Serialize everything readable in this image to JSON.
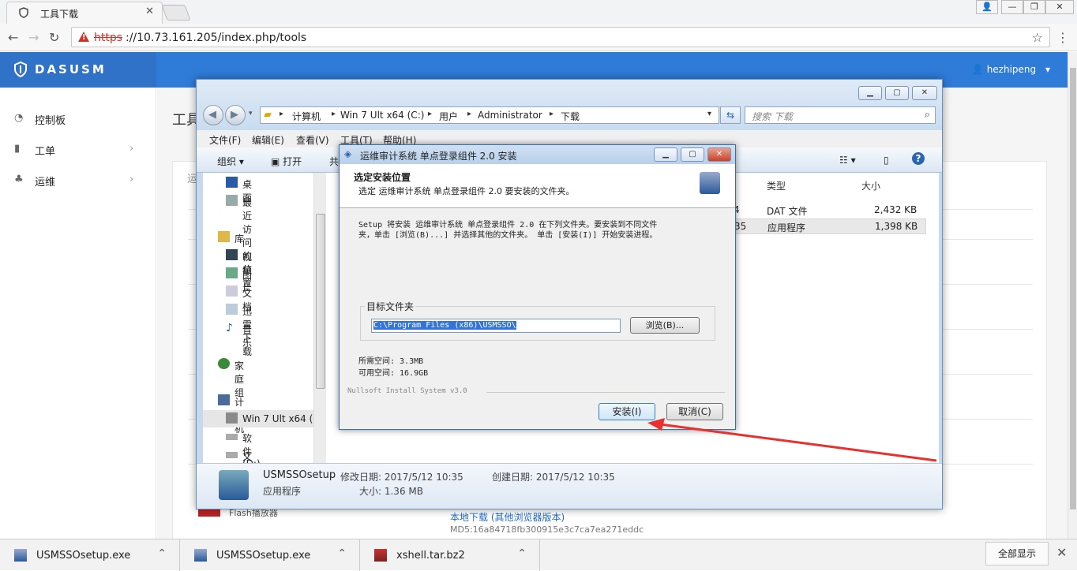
{
  "browser": {
    "tab_title": "工具下载",
    "url_scheme": "https",
    "url_rest": "://10.73.161.205/index.php/tools"
  },
  "app": {
    "brand": "DASUSM",
    "user": "hezhipeng",
    "page_title_fragment": "工具",
    "tab_fragment": "运",
    "sidebar": [
      {
        "label": "控制板",
        "icon": "dashboard-icon"
      },
      {
        "label": "工单",
        "icon": "file-icon"
      },
      {
        "label": "运维",
        "icon": "sitemap-icon"
      }
    ],
    "flash_label": "Flash播放器",
    "download_link": "本地下载 (其他浏览器版本)",
    "md5": "MD5:16a84718fb300915e3c7ca7ea271eddc"
  },
  "explorer": {
    "breadcrumb": [
      "计算机",
      "Win 7 Ult x64 (C:)",
      "用户",
      "Administrator",
      "下载"
    ],
    "search_placeholder": "搜索 下载",
    "menu": [
      "文件(F)",
      "编辑(E)",
      "查看(V)",
      "工具(T)",
      "帮助(H)"
    ],
    "commands": [
      "组织",
      "打开",
      "共"
    ],
    "nav_items": [
      "桌面",
      "最近访问的位置",
      "库",
      "视频",
      "图片",
      "文档",
      "迅雷下载",
      "音乐",
      "家庭组",
      "计算机",
      "Win 7 Ult x64 (C",
      "软件 (D:)",
      "文档 (E:)"
    ],
    "columns": {
      "type": "类型",
      "size": "大小"
    },
    "files": [
      {
        "frag": "4",
        "type": "DAT 文件",
        "size": "2,432 KB"
      },
      {
        "frag": "35",
        "type": "应用程序",
        "size": "1,398 KB"
      }
    ],
    "details": {
      "name": "USMSSOsetup",
      "modified_label": "修改日期: 2017/5/12 10:35",
      "created_label": "创建日期: 2017/5/12 10:35",
      "kind": "应用程序",
      "size_label": "大小: 1.36 MB"
    }
  },
  "installer": {
    "title": "运维审计系统 单点登录组件 2.0 安装",
    "heading": "选定安装位置",
    "subheading": "选定 运维审计系统 单点登录组件 2.0 要安装的文件夹。",
    "body_line1": "Setup 将安装 运维审计系统 单点登录组件 2.0 在下列文件夹。要安装到不同文件",
    "body_line2": "夹，单击 [浏览(B)...] 并选择其他的文件夹。 单击 [安装(I)] 开始安装进程。",
    "group_label": "目标文件夹",
    "path": "C:\\Program Files (x86)\\USMSSO\\",
    "browse": "浏览(B)...",
    "space_required": "所需空间: 3.3MB",
    "space_available": "可用空间: 16.9GB",
    "branding": "Nullsoft Install System v3.0",
    "install": "安装(I)",
    "cancel": "取消(C)"
  },
  "downloads": [
    {
      "name": "USMSSOsetup.exe"
    },
    {
      "name": "USMSSOsetup.exe"
    },
    {
      "name": "xshell.tar.bz2"
    }
  ],
  "downloads_show_all": "全部显示",
  "colors": {
    "header_blue": "#2e7bd8",
    "arrow_red": "#e8312f"
  }
}
